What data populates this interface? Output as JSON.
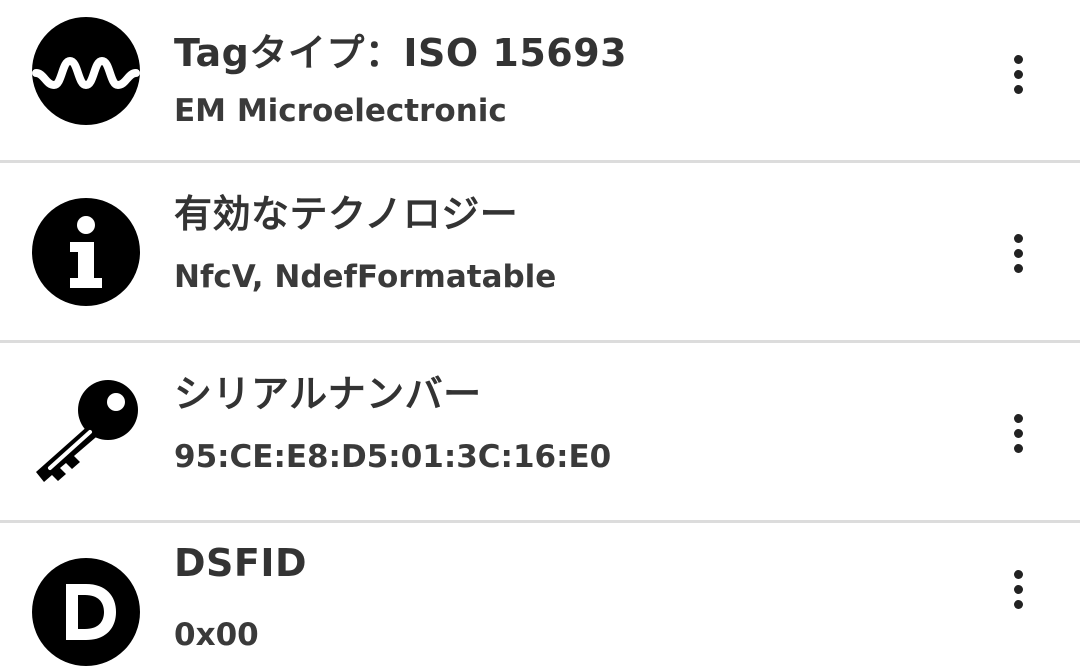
{
  "items": [
    {
      "icon": "waveform-icon",
      "title": "Tagタイプ：ISO 15693",
      "subtitle": "EM Microelectronic"
    },
    {
      "icon": "info-icon",
      "title": "有効なテクノロジー",
      "subtitle": "NfcV, NdefFormatable"
    },
    {
      "icon": "key-icon",
      "title": "シリアルナンバー",
      "subtitle": "95:CE:E8:D5:01:3C:16:E0"
    },
    {
      "icon": "letter-d-icon",
      "title": "DSFID",
      "subtitle": "0x00"
    }
  ],
  "colors": {
    "icon": "#000000",
    "divider": "#dcdcdc",
    "text": "#333333"
  }
}
